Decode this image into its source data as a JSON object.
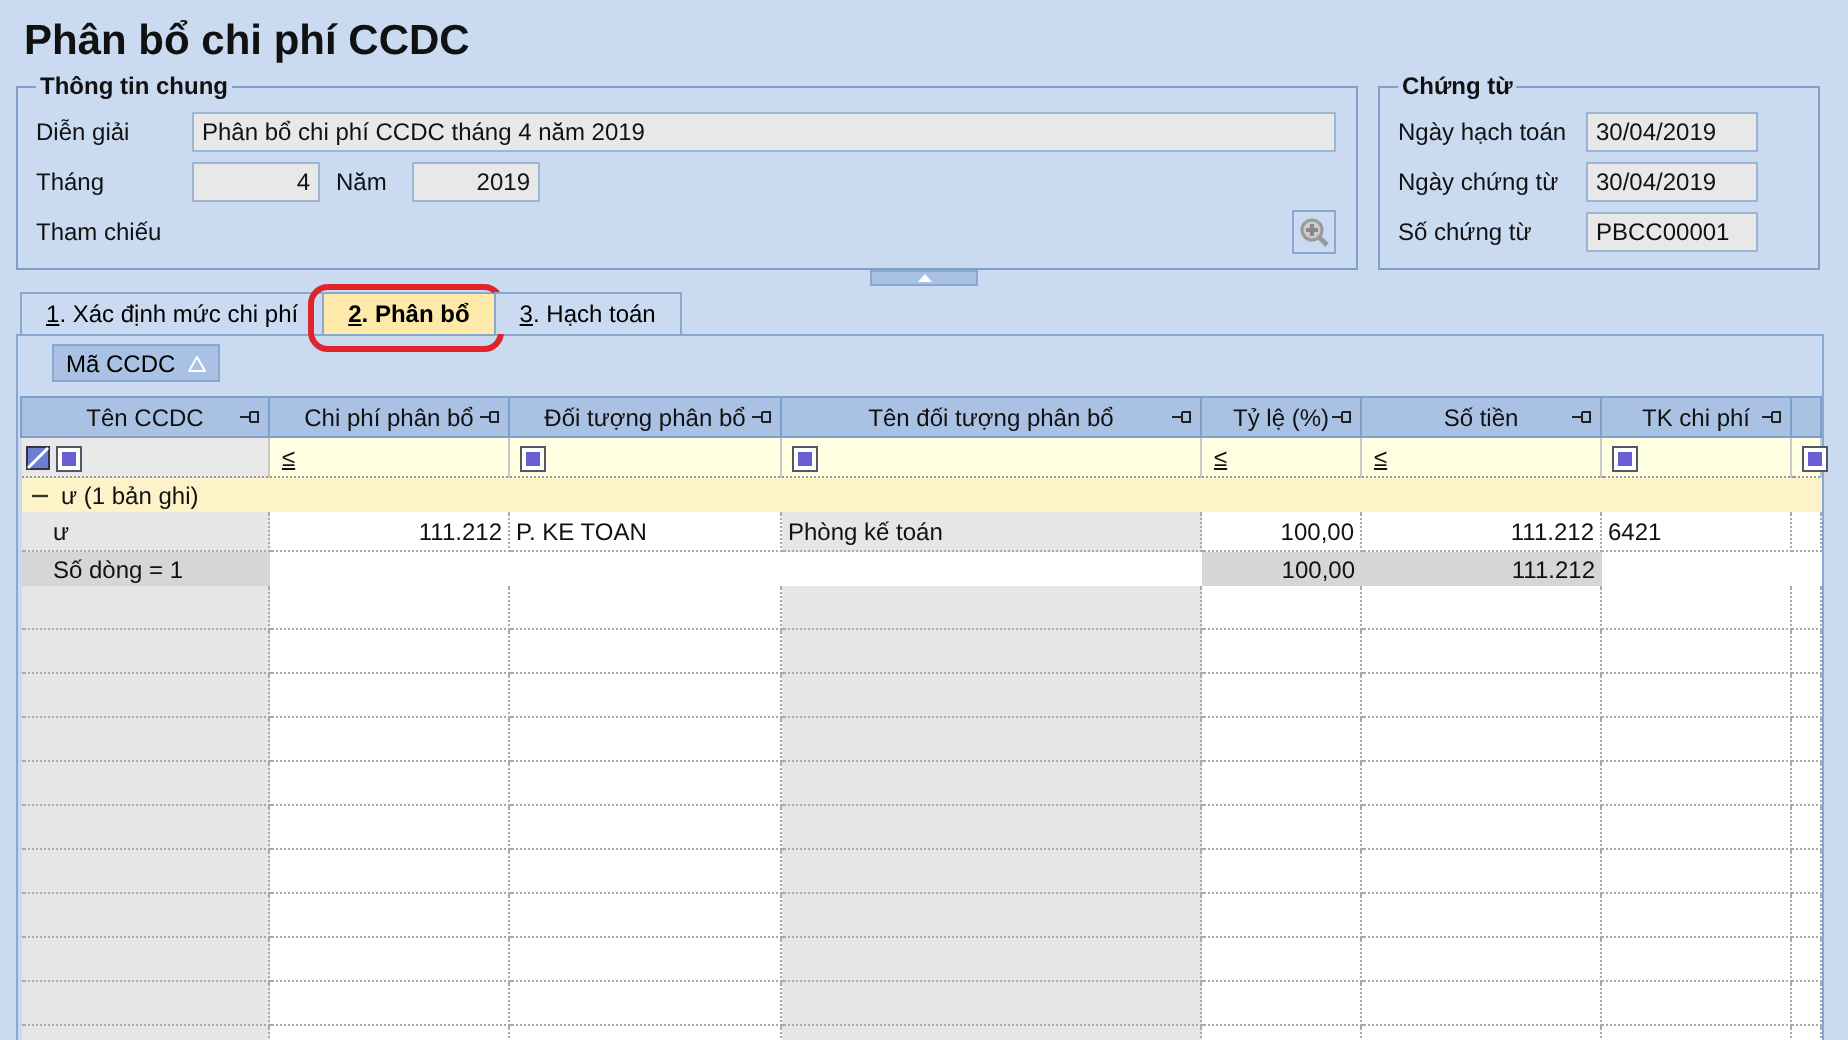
{
  "title": "Phân bổ chi phí CCDC",
  "general": {
    "legend": "Thông tin chung",
    "description": {
      "label": "Diễn giải",
      "value": "Phân bổ chi phí CCDC tháng 4 năm 2019"
    },
    "month": {
      "label": "Tháng",
      "value": "4"
    },
    "year": {
      "label": "Năm",
      "value": "2019"
    },
    "reference": {
      "label": "Tham chiếu"
    }
  },
  "voucher": {
    "legend": "Chứng từ",
    "fields": [
      {
        "label": "Ngày hạch toán",
        "value": "30/04/2019"
      },
      {
        "label": "Ngày chứng từ",
        "value": "30/04/2019"
      },
      {
        "label": "Số chứng từ",
        "value": "PBCC00001"
      }
    ]
  },
  "tabs": [
    {
      "key": "1",
      "label": ". Xác định mức chi phí",
      "selected": false,
      "highlighted": false
    },
    {
      "key": "2",
      "label": ". Phân bổ",
      "selected": true,
      "highlighted": true
    },
    {
      "key": "3",
      "label": ". Hạch toán",
      "selected": false,
      "highlighted": false
    }
  ],
  "group_by": {
    "label": "Mã CCDC"
  },
  "table": {
    "columns": [
      {
        "label": "Tên CCDC",
        "kind": "check"
      },
      {
        "label": "Chi phí phân bổ",
        "kind": "op",
        "op": "≤"
      },
      {
        "label": "Đối tượng phân bổ",
        "kind": "check"
      },
      {
        "label": "Tên đối tượng phân bổ",
        "kind": "check"
      },
      {
        "label": "Tỷ lệ (%)",
        "kind": "op",
        "op": "≤"
      },
      {
        "label": "Số tiền",
        "kind": "op",
        "op": "≤"
      },
      {
        "label": "TK chi phí",
        "kind": "check"
      }
    ],
    "group": {
      "label": "ư (1 bản ghi)",
      "expanded": true
    },
    "rows": [
      {
        "cells": [
          "ư",
          "111.212",
          "P. KE TOAN",
          "Phòng kế toán",
          "100,00",
          "111.212",
          "6421"
        ]
      }
    ],
    "footer": [
      {
        "kind": "count",
        "text": "Số dòng = 1"
      },
      {
        "kind": "blank"
      },
      {
        "kind": "blank"
      },
      {
        "kind": "blank"
      },
      {
        "kind": "total",
        "text": "100,00"
      },
      {
        "kind": "total",
        "text": "111.212"
      },
      {
        "kind": "blank"
      }
    ]
  }
}
